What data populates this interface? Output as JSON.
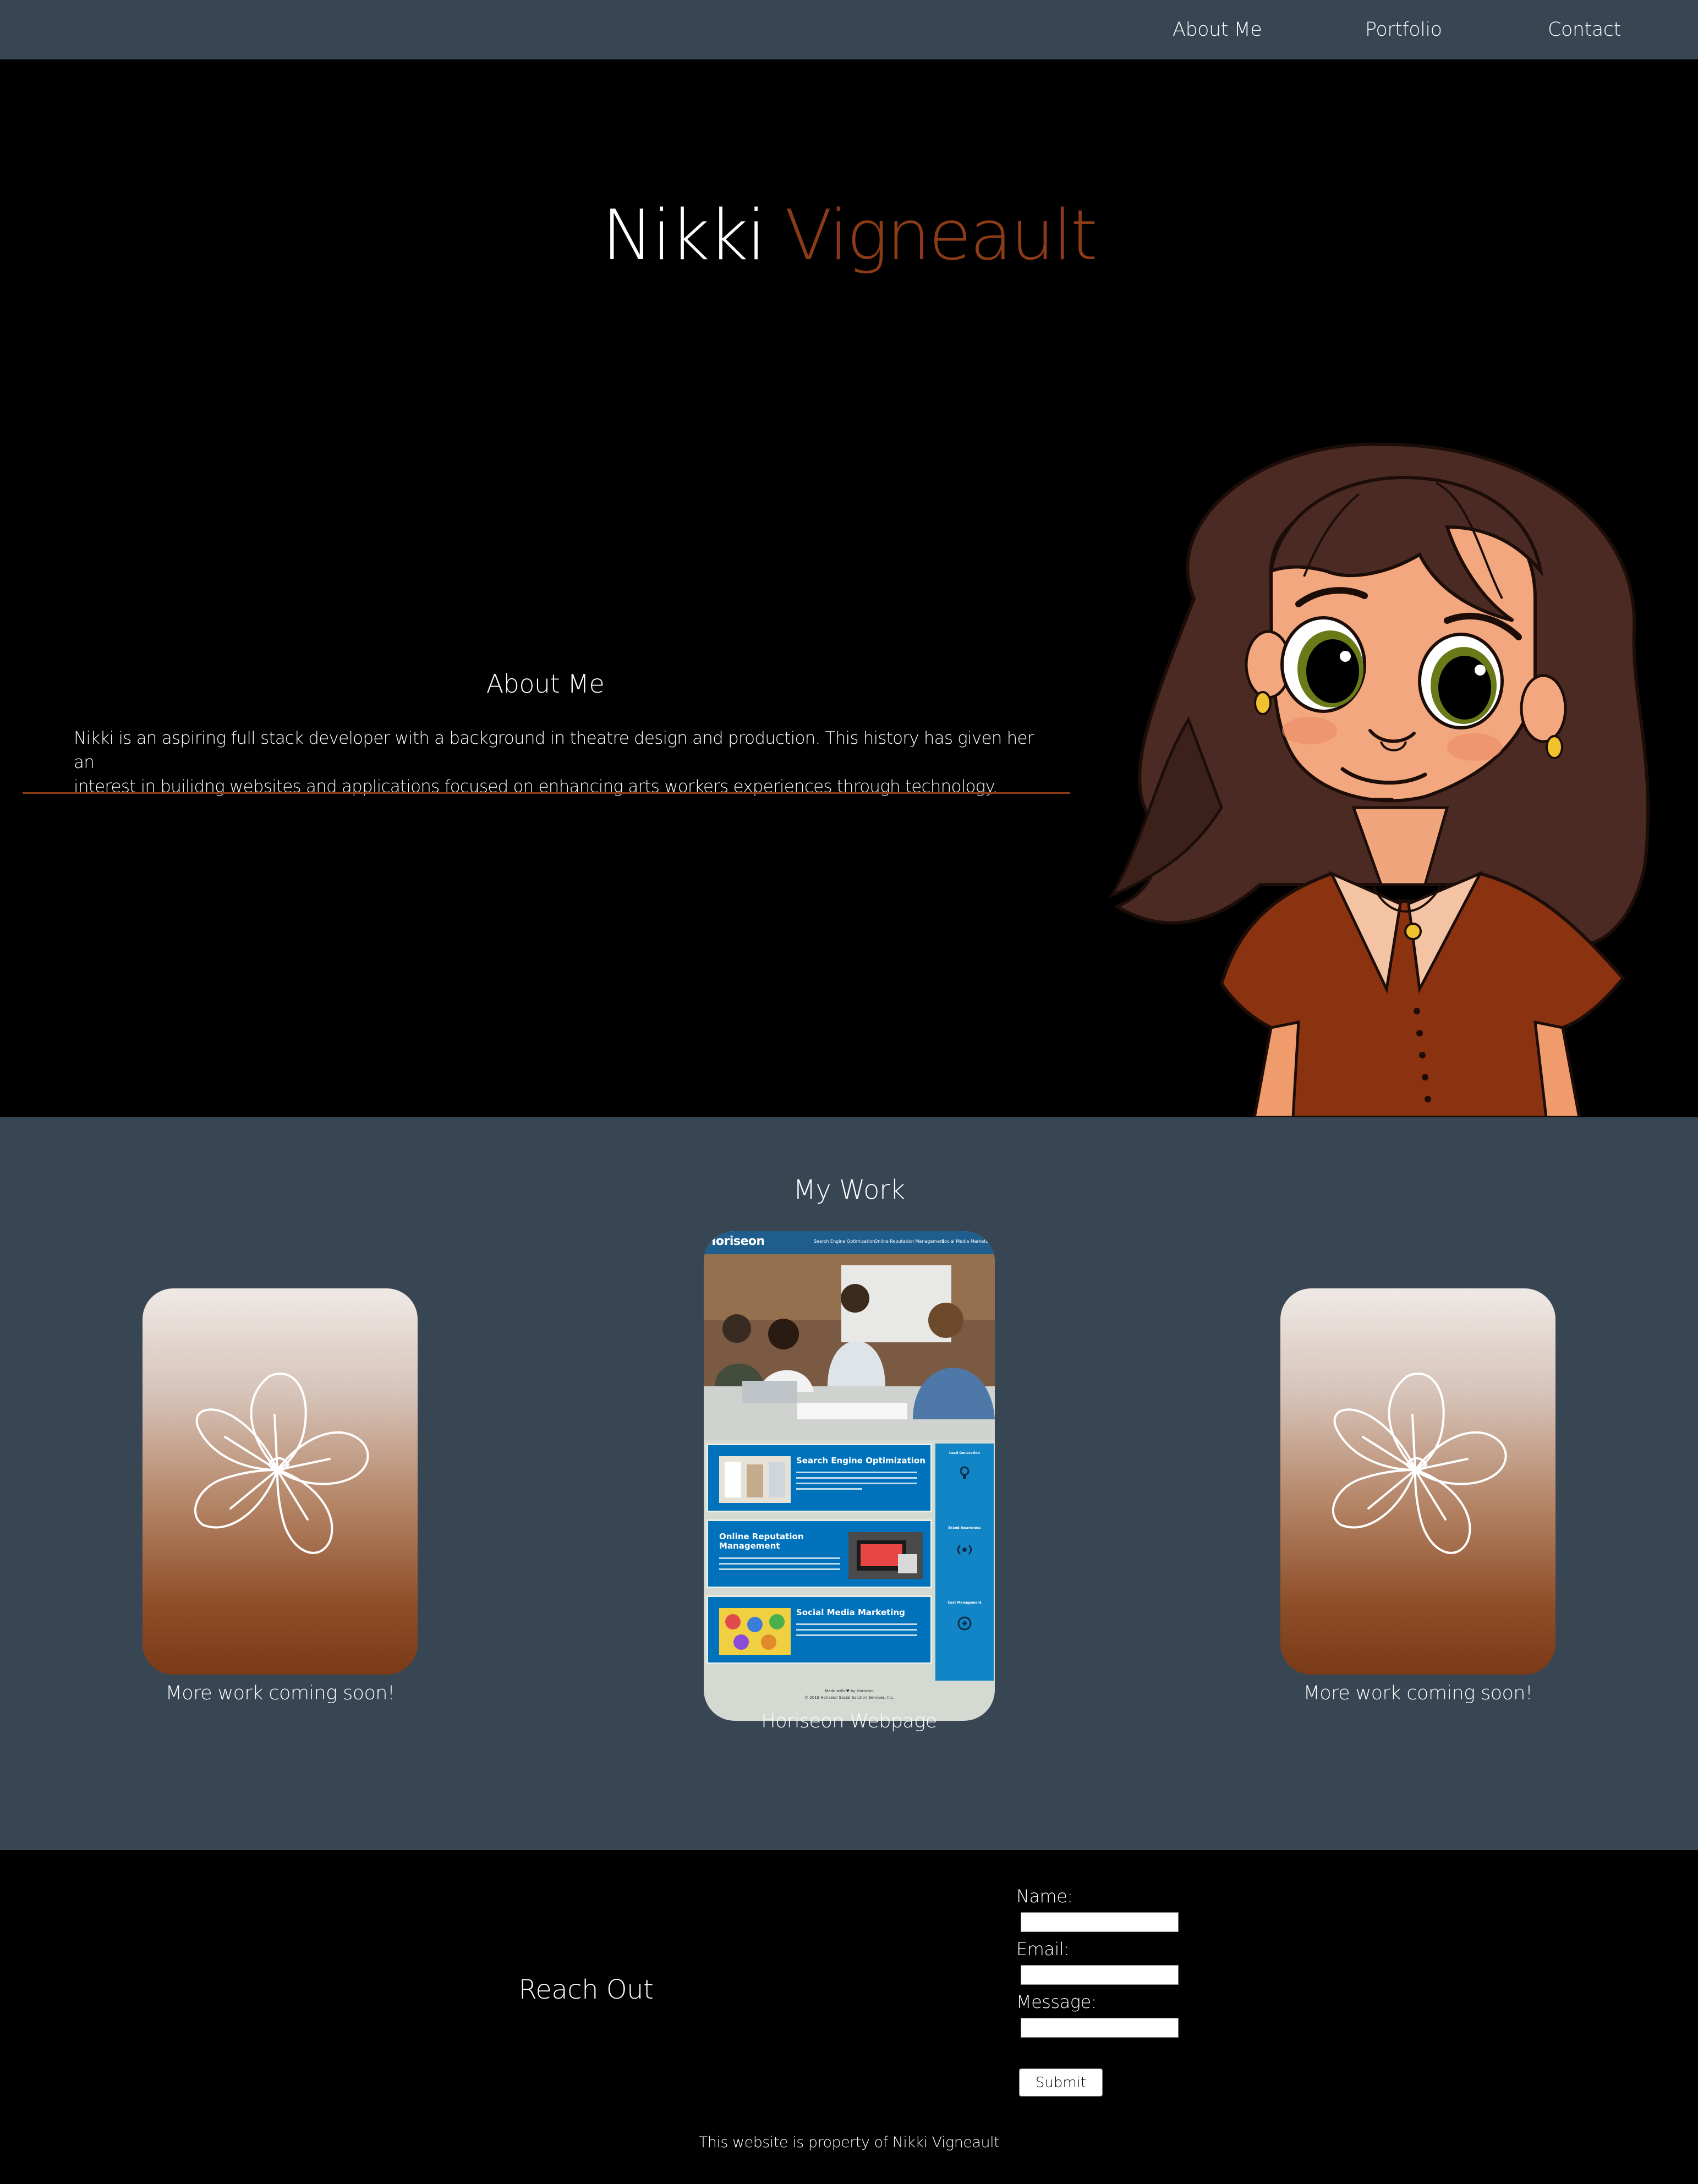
{
  "nav": {
    "items": [
      {
        "label": "About Me"
      },
      {
        "label": "Portfolio"
      },
      {
        "label": "Contact"
      }
    ]
  },
  "hero": {
    "first_name": "Nikki",
    "last_name": "Vigneault"
  },
  "about": {
    "title": "About Me",
    "text_line1": "Nikki is an aspiring full stack developer with a background in theatre design and production. This history has given her an",
    "text_line2": "interest in builidng websites and applications focused on enhancing arts workers experiences through technology."
  },
  "work": {
    "title": "My Work",
    "cards": [
      {
        "caption": "More work coming soon!"
      },
      {
        "caption": "Horiseon Webpage"
      },
      {
        "caption": "More work coming soon!"
      }
    ],
    "horiseon_preview": {
      "logo": "Horiseon",
      "menu": [
        "Search Engine Optimization",
        "Online Reputation Management",
        "Social Media Marketing"
      ],
      "sections": [
        "Search Engine Optimization",
        "Online Reputation Management",
        "Social Media Marketing"
      ],
      "sidebar": [
        "Lead Generation",
        "Brand Awareness",
        "Cost Management"
      ],
      "footer": "Made with ♥ by Horiseon",
      "copyright": "© 2019 Horiseon Social Solution Services, Inc."
    }
  },
  "contact": {
    "title": "Reach Out",
    "name_label": "Name:",
    "email_label": "Email:",
    "message_label": "Message:",
    "submit_label": "Submit"
  },
  "footer": {
    "text": "This website is property of Nikki Vigneault"
  },
  "colors": {
    "nav_bg": "#384654",
    "accent": "#8c3b17",
    "page_bg": "#000000",
    "section_bg": "#384654"
  }
}
